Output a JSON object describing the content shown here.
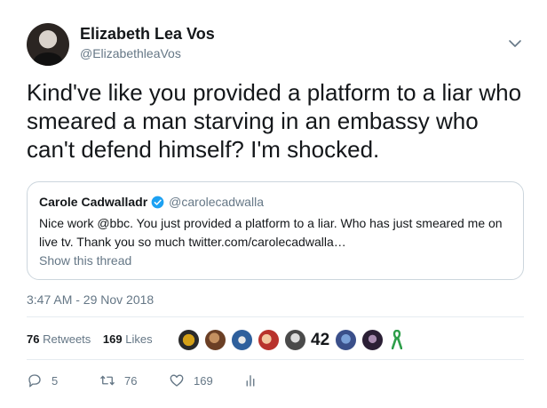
{
  "author": {
    "name": "Elizabeth Lea Vos",
    "handle": "@ElizabethleaVos"
  },
  "tweet": {
    "text": "Kind've like you provided a platform to a liar who smeared a man starving in an embassy who can't defend himself? I'm shocked.",
    "timestamp": "3:47 AM - 29 Nov 2018"
  },
  "quoted_tweet": {
    "name": "Carole Cadwalladr",
    "handle": "@carolecadwalla",
    "text": "Nice work @bbc. You just provided a platform to a liar. Who has just smeared me on live tv. Thank you so much twitter.com/carolecadwalla…",
    "show_thread": "Show this thread",
    "verified_icon": "verified-badge-icon"
  },
  "stats": {
    "retweets_count": "76",
    "retweets_label": "Retweets",
    "likes_count": "169",
    "likes_label": "Likes"
  },
  "likers": {
    "number_avatar_text": "42",
    "avatar_colors": [
      "#b88a2a",
      "#8a5a3a",
      "#3a6ea5",
      "#c7413c",
      "#5b5b5b",
      "#4a6fb0",
      "#3b2a4a"
    ],
    "ribbon_color": "#2e9e4a"
  },
  "actions": {
    "reply_count": "5",
    "retweet_count": "76",
    "like_count": "169"
  },
  "colors": {
    "text_primary": "#14171a",
    "text_secondary": "#657786",
    "border": "#ccd6dd",
    "verified": "#1da1f2"
  }
}
